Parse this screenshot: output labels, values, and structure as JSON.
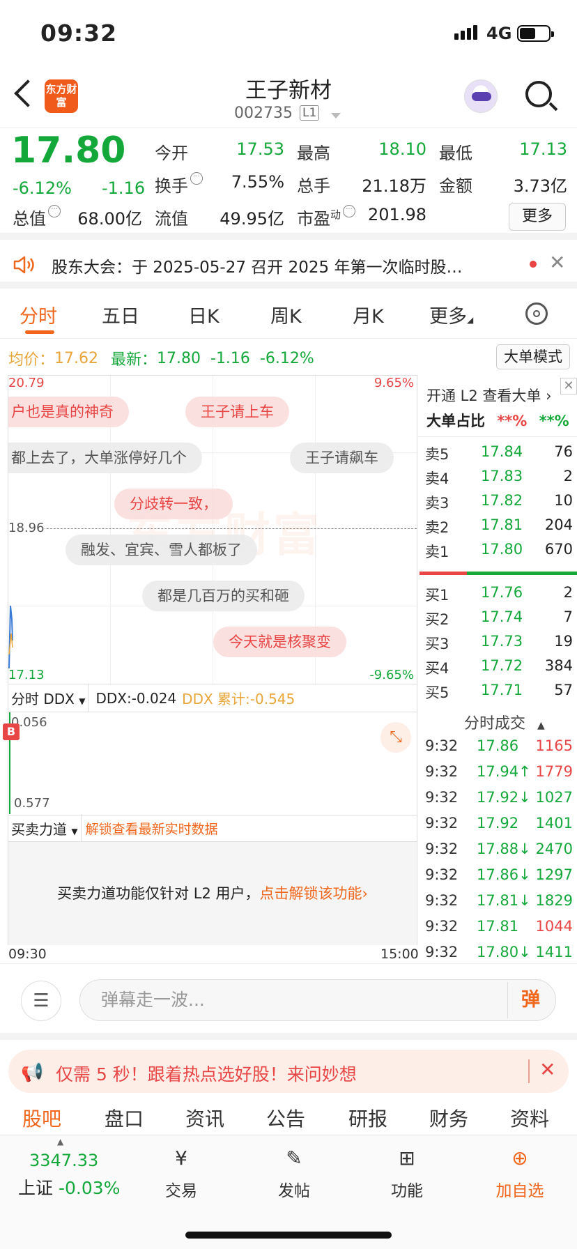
{
  "status": {
    "time": "09:32",
    "network": "4G"
  },
  "header": {
    "logo_text": "东方财富",
    "title": "王子新材",
    "code": "002735",
    "level_badge": "L1"
  },
  "quote": {
    "price": "17.80",
    "change_pct": "-6.12%",
    "change": "-1.16",
    "fields": [
      {
        "label": "今开",
        "value": "17.53",
        "color": "green"
      },
      {
        "label": "最高",
        "value": "18.10",
        "color": "green"
      },
      {
        "label": "最低",
        "value": "17.13",
        "color": "green"
      },
      {
        "label": "换手",
        "value": "7.55%",
        "color": "dark"
      },
      {
        "label": "总手",
        "value": "21.18万",
        "color": "dark"
      },
      {
        "label": "金额",
        "value": "3.73亿",
        "color": "dark"
      },
      {
        "label": "总值",
        "value": "68.00亿",
        "color": "dark"
      },
      {
        "label": "流值",
        "value": "49.95亿",
        "color": "dark"
      },
      {
        "label": "市盈",
        "sup": "动",
        "value": "201.98",
        "color": "dark"
      }
    ],
    "more_label": "更多"
  },
  "notice": {
    "text": "股东大会：于 2025-05-27 召开 2025 年第一次临时股…"
  },
  "tabs": [
    "分时",
    "五日",
    "日K",
    "周K",
    "月K",
    "更多"
  ],
  "info_line": {
    "avg_label": "均价：",
    "avg_value": "17.62",
    "latest_label": "最新：",
    "latest_value": "17.80",
    "latest_change": "-1.16",
    "latest_pct": "-6.12%",
    "big_order_button": "大单模式"
  },
  "chart": {
    "top_price": "20.79",
    "top_pct": "9.65%",
    "mid_price": "18.96",
    "bottom_price": "17.13",
    "bottom_pct": "-9.65%",
    "watermark": "东方财富",
    "danmu": [
      "户也是真的神奇",
      "王子请上车",
      "都上去了，大单涨停好几个",
      "王子请飙车",
      "分歧转一致，",
      "融发、宜宾、雪人都板了",
      "都是几百万的买和砸",
      "今天就是核聚变"
    ]
  },
  "ddx": {
    "selector": "分时 DDX",
    "ddx_label": "DDX:-0.024",
    "cum_label": "DDX 累计:-0.545",
    "top": "0.056",
    "bottom": "0.577",
    "badge": "B"
  },
  "force": {
    "selector": "买卖力道",
    "unlock_label": "解锁查看最新实时数据",
    "body_text": "买卖力道功能仅针对 L2 用户，",
    "body_link": "点击解锁该功能",
    "time_start": "09:30",
    "time_end": "15:00"
  },
  "order_book": {
    "head1": "开通 L2 查看大单 ›",
    "head2": "大单占比",
    "head2_v1": "**%",
    "head2_v2": "**%",
    "asks": [
      {
        "n": "卖5",
        "p": "17.84",
        "v": "76"
      },
      {
        "n": "卖4",
        "p": "17.83",
        "v": "2"
      },
      {
        "n": "卖3",
        "p": "17.82",
        "v": "10"
      },
      {
        "n": "卖2",
        "p": "17.81",
        "v": "204"
      },
      {
        "n": "卖1",
        "p": "17.80",
        "v": "670"
      }
    ],
    "bids": [
      {
        "n": "买1",
        "p": "17.76",
        "v": "2"
      },
      {
        "n": "买2",
        "p": "17.74",
        "v": "7"
      },
      {
        "n": "买3",
        "p": "17.73",
        "v": "19"
      },
      {
        "n": "买4",
        "p": "17.72",
        "v": "384"
      },
      {
        "n": "买5",
        "p": "17.71",
        "v": "57"
      }
    ],
    "trades_title": "分时成交",
    "trades": [
      {
        "t": "9:32",
        "p": "17.86",
        "v": "1165",
        "vc": "red"
      },
      {
        "t": "9:32",
        "p": "17.94↑",
        "v": "1779",
        "vc": "red"
      },
      {
        "t": "9:32",
        "p": "17.92↓",
        "v": "1027",
        "vc": "green"
      },
      {
        "t": "9:32",
        "p": "17.92",
        "v": "1401",
        "vc": "green"
      },
      {
        "t": "9:32",
        "p": "17.88↓",
        "v": "2470",
        "vc": "green"
      },
      {
        "t": "9:32",
        "p": "17.86↓",
        "v": "1297",
        "vc": "green"
      },
      {
        "t": "9:32",
        "p": "17.81↓",
        "v": "1829",
        "vc": "green"
      },
      {
        "t": "9:32",
        "p": "17.81",
        "v": "1044",
        "vc": "red"
      },
      {
        "t": "9:32",
        "p": "17.80↓",
        "v": "1411",
        "vc": "green"
      }
    ]
  },
  "comment": {
    "placeholder": "弹幕走一波...",
    "danmu_button": "弹"
  },
  "ad": {
    "text": "仅需 5 秒！跟着热点选好股！来问妙想"
  },
  "bottom_tabs": [
    "股吧",
    "盘口",
    "资讯",
    "公告",
    "研报",
    "财务",
    "资料"
  ],
  "bottom_nav": {
    "index_value": "3347.33",
    "index_name": "上证",
    "index_pct": "-0.03%",
    "items": [
      "交易",
      "发帖",
      "功能",
      "加自选"
    ]
  },
  "colors": {
    "accent": "#f0661c",
    "up": "#e84545",
    "down": "#14a83b"
  }
}
